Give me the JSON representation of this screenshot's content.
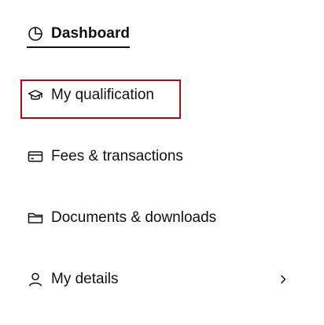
{
  "nav": {
    "items": [
      {
        "id": "dashboard",
        "label": "Dashboard",
        "icon": "pie-chart-icon",
        "active": true
      },
      {
        "id": "qualification",
        "label": "My qualification",
        "icon": "graduation-cap-icon",
        "highlighted": true
      },
      {
        "id": "fees",
        "label": "Fees & transactions",
        "icon": "credit-card-icon"
      },
      {
        "id": "documents",
        "label": "Documents & downloads",
        "icon": "folder-icon"
      },
      {
        "id": "details",
        "label": "My details",
        "icon": "user-icon",
        "has_submenu": true,
        "submenu_icon": "chevron-right-icon"
      }
    ]
  },
  "colors": {
    "text": "#111111",
    "highlight_border": "#a30d16",
    "background": "#ffffff"
  }
}
